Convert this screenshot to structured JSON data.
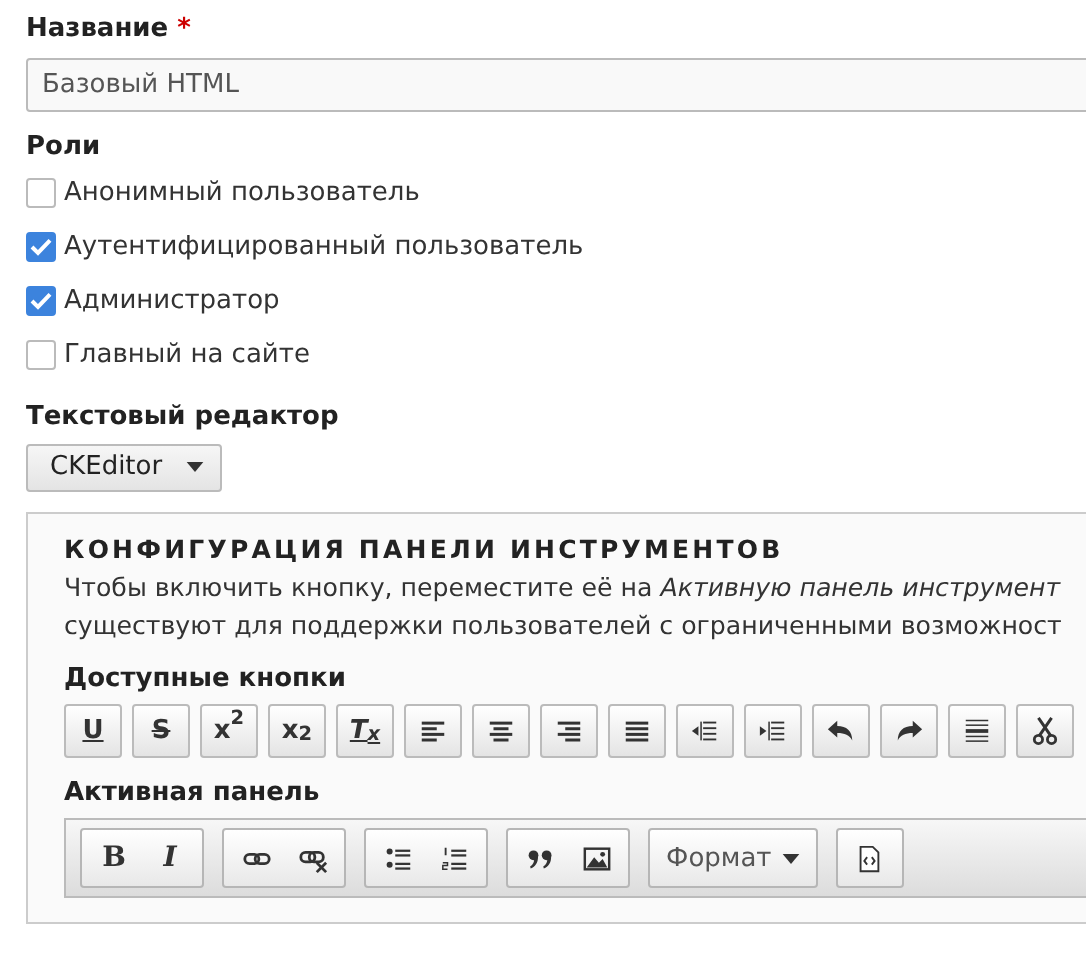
{
  "name_field": {
    "label": "Название",
    "required_mark": "*",
    "value": "Базовый HTML"
  },
  "roles": {
    "label": "Роли",
    "items": [
      {
        "label": "Анонимный пользователь",
        "checked": false
      },
      {
        "label": "Аутентифицированный пользователь",
        "checked": true
      },
      {
        "label": "Администратор",
        "checked": true
      },
      {
        "label": "Главный на сайте",
        "checked": false
      }
    ]
  },
  "text_editor": {
    "label": "Текстовый редактор",
    "value": "CKEditor"
  },
  "toolbar_config": {
    "title": "КОНФИГУРАЦИЯ ПАНЕЛИ ИНСТРУМЕНТОВ",
    "description": [
      "Чтобы включить кнопку, переместите её на *Активную панель инструмент*",
      "существуют для поддержки пользователей с ограниченными возможност"
    ],
    "available_label": "Доступные кнопки",
    "available_buttons": [
      {
        "kind": "underline",
        "label": "U"
      },
      {
        "kind": "strike",
        "label": "S"
      },
      {
        "kind": "text",
        "label": "x$^{2}$"
      },
      {
        "kind": "text",
        "label": "x$_{2}$"
      },
      {
        "kind": "remove-format",
        "label": "T$_{x}$"
      },
      {
        "kind": "align-left"
      },
      {
        "kind": "align-center"
      },
      {
        "kind": "align-right"
      },
      {
        "kind": "justify"
      },
      {
        "kind": "outdent"
      },
      {
        "kind": "indent"
      },
      {
        "kind": "undo"
      },
      {
        "kind": "redo"
      },
      {
        "kind": "horizontal-rule"
      },
      {
        "kind": "cut"
      }
    ],
    "active_label": "Активная панель",
    "active_groups": [
      [
        {
          "kind": "bold",
          "label": "B"
        },
        {
          "kind": "italic",
          "label": "I"
        }
      ],
      [
        {
          "kind": "link"
        },
        {
          "kind": "unlink"
        }
      ],
      [
        {
          "kind": "bulleted-list"
        },
        {
          "kind": "numbered-list"
        }
      ],
      [
        {
          "kind": "quote"
        },
        {
          "kind": "image"
        }
      ],
      [
        {
          "kind": "dropdown",
          "label": "Формат"
        }
      ],
      [
        {
          "kind": "source"
        }
      ]
    ]
  }
}
